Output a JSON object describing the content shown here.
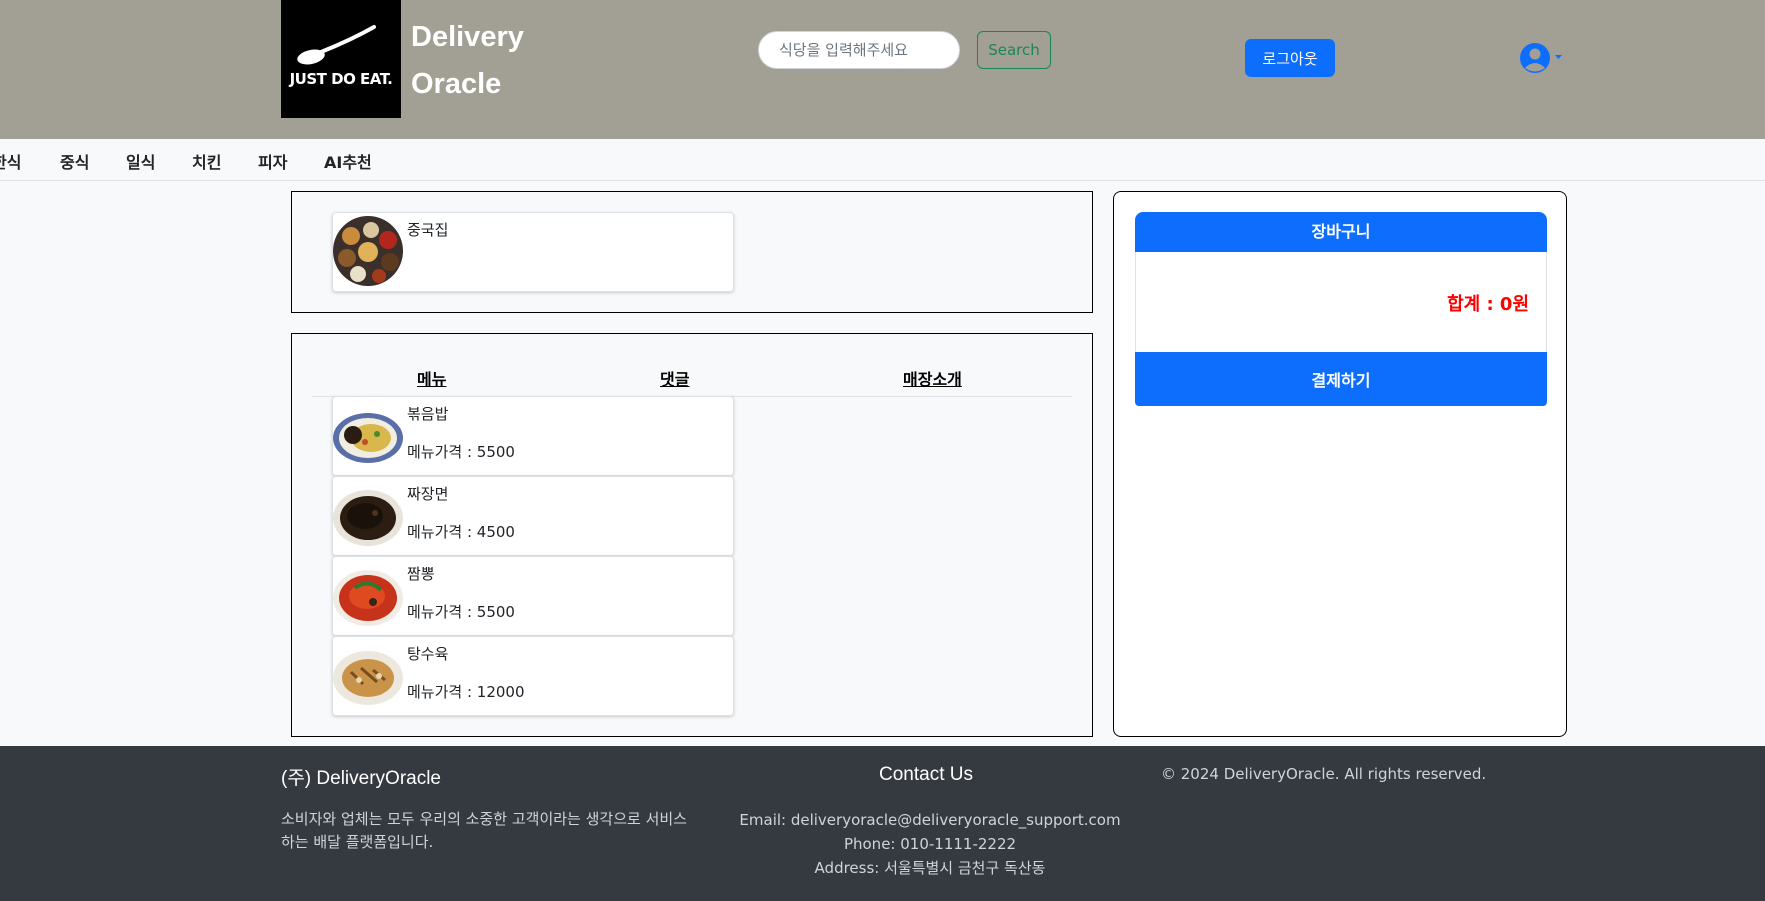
{
  "header": {
    "logo_text": "JUST DO EAT.",
    "brand_line1": "Delivery",
    "brand_line2": "Oracle",
    "search_placeholder": "식당을 입력해주세요",
    "search_button": "Search",
    "logout_button": "로그아웃",
    "user_icon": "user-circle-icon"
  },
  "categories": [
    "한식",
    "중식",
    "일식",
    "치킨",
    "피자",
    "AI추천"
  ],
  "store": {
    "name": "중국집"
  },
  "tabs": [
    "메뉴",
    "댓글",
    "매장소개"
  ],
  "price_label": "메뉴가격 : ",
  "menu_items": [
    {
      "name": "볶음밥",
      "price": "5500"
    },
    {
      "name": "짜장면",
      "price": "4500"
    },
    {
      "name": "짬뽕",
      "price": "5500"
    },
    {
      "name": "탕수육",
      "price": "12000"
    }
  ],
  "cart": {
    "title": "장바구니",
    "total": "합계 : 0원",
    "checkout_button": "결제하기"
  },
  "footer": {
    "company": "(주) DeliveryOracle",
    "description": "소비자와 업체는 모두 우리의 소중한 고객이라는 생각으로 서비스하는 배달 플랫폼입니다.",
    "contact_title": "Contact Us",
    "email": "Email: deliveryoracle@deliveryoracle_support.com",
    "phone": "Phone: 010-1111-2222",
    "address": "Address: 서울특별시 금천구 독산동",
    "copyright": "© 2024 DeliveryOracle. All rights reserved."
  },
  "colors": {
    "header_bg": "#a29f94",
    "primary": "#0d6efd",
    "success": "#198754",
    "footer_bg": "#343a40",
    "total_text": "#ff0000"
  }
}
